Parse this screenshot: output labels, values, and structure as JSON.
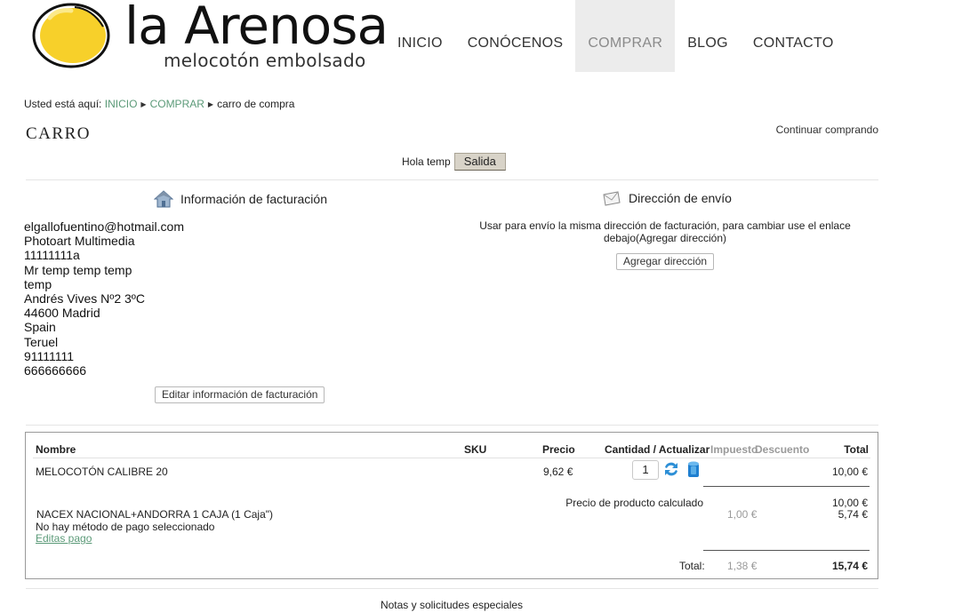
{
  "logo": {
    "title": "la Arenosa",
    "subtitle": "melocotón embolsado"
  },
  "nav": {
    "items": [
      {
        "label": "INICIO",
        "active": false
      },
      {
        "label": "CONÓCENOS",
        "active": false
      },
      {
        "label": "COMPRAR",
        "active": true
      },
      {
        "label": "BLOG",
        "active": false
      },
      {
        "label": "CONTACTO",
        "active": false
      }
    ]
  },
  "breadcrumb": {
    "prefix": "Usted está aquí:",
    "home": "INICIO",
    "section": "COMPRAR",
    "current": "carro de compra"
  },
  "page": {
    "title": "CARRO",
    "continue_link": "Continuar comprando",
    "greeting": "Hola temp",
    "logout_label": "Salida"
  },
  "billing": {
    "heading": "Información de facturación",
    "lines": [
      "elgallofuentino@hotmail.com",
      "Photoart Multimedia",
      "11111111a",
      "Mr temp temp temp",
      "temp",
      "Andrés Vives Nº2 3ºC",
      "44600 Madrid",
      "Spain",
      "Teruel",
      "91111111",
      "666666666"
    ],
    "edit_label": "Editar información de facturación"
  },
  "shipping": {
    "heading": "Dirección de envío",
    "text": "Usar para envío la misma dirección de facturación, para cambiar use el enlace debajo(Agregar dirección)",
    "add_label": "Agregar dirección"
  },
  "cart": {
    "headers": {
      "name": "Nombre",
      "sku": "SKU",
      "price": "Precio",
      "qty": "Cantidad / Actualizar",
      "tax": "Impuesto",
      "discount": "Descuento",
      "total": "Total"
    },
    "items": [
      {
        "name": "MELOCOTÓN CALIBRE 20",
        "sku": "",
        "price": "9,62 €",
        "qty": "1",
        "total": "10,00 €"
      }
    ],
    "subtotal_label": "Precio de producto calculado",
    "subtotal_value": "10,00 €",
    "shipping_name": "NACEX NACIONAL+ANDORRA 1 CAJA (1 Caja\")",
    "shipping_tax": "1,00 €",
    "shipping_total": "5,74 €",
    "payment_text": "No hay método de pago seleccionado",
    "payment_edit": "Editas pago",
    "grand_label": "Total:",
    "grand_tax": "1,38 €",
    "grand_total": "15,74 €"
  },
  "notes": {
    "label": "Notas y solicitudes especiales"
  },
  "colors": {
    "link_green": "#5b9a78",
    "nav_active_bg": "#ececec",
    "logo_yellow": "#f7d02a"
  }
}
